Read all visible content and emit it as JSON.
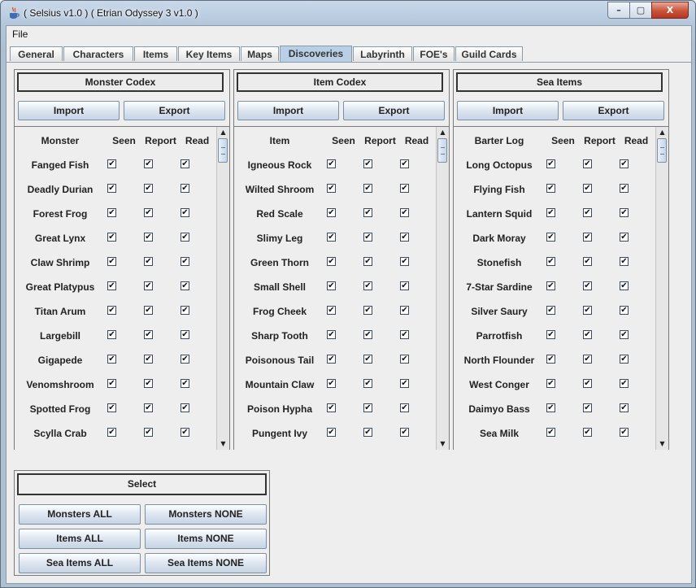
{
  "window": {
    "title": "( Selsius v1.0 ) ( Etrian Odyssey 3 v1.0 )"
  },
  "window_buttons": {
    "minimize": "–",
    "maximize": "▢",
    "close": "X"
  },
  "menu": {
    "file": "File"
  },
  "tabs": [
    "General",
    "Characters",
    "Items",
    "Key Items",
    "Maps",
    "Discoveries",
    "Labyrinth",
    "FOE's",
    "Guild Cards"
  ],
  "active_tab": "Discoveries",
  "check_mark": "✔",
  "scroll": {
    "up": "▲",
    "down": "▼"
  },
  "columns": {
    "seen": "Seen",
    "report": "Report",
    "read": "Read"
  },
  "panels": [
    {
      "title": "Monster Codex",
      "import_label": "Import",
      "export_label": "Export",
      "name_header": "Monster",
      "items": [
        "Fanged Fish",
        "Deadly Durian",
        "Forest Frog",
        "Great Lynx",
        "Claw Shrimp",
        "Great Platypus",
        "Titan Arum",
        "Largebill",
        "Gigapede",
        "Venomshroom",
        "Spotted Frog",
        "Scylla Crab"
      ]
    },
    {
      "title": "Item Codex",
      "import_label": "Import",
      "export_label": "Export",
      "name_header": "Item",
      "items": [
        "Igneous Rock",
        "Wilted Shroom",
        "Red Scale",
        "Slimy Leg",
        "Green Thorn",
        "Small Shell",
        "Frog Cheek",
        "Sharp Tooth",
        "Poisonous Tail",
        "Mountain Claw",
        "Poison Hypha",
        "Pungent Ivy"
      ]
    },
    {
      "title": "Sea Items",
      "import_label": "Import",
      "export_label": "Export",
      "name_header": "Barter Log",
      "items": [
        "Long Octopus",
        "Flying Fish",
        "Lantern Squid",
        "Dark Moray",
        "Stonefish",
        "7-Star Sardine",
        "Silver Saury",
        "Parrotfish",
        "North Flounder",
        "West Conger",
        "Daimyo Bass",
        "Sea Milk"
      ]
    }
  ],
  "select": {
    "title": "Select",
    "buttons": [
      "Monsters ALL",
      "Monsters NONE",
      "Items ALL",
      "Items NONE",
      "Sea Items ALL",
      "Sea Items NONE"
    ]
  }
}
